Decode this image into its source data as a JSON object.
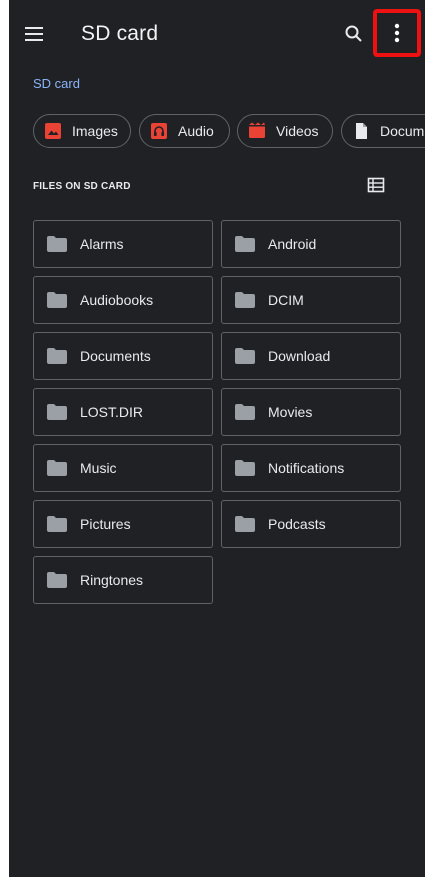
{
  "appbar": {
    "menu_icon": "hamburger-menu-icon",
    "title": "SD card",
    "search_icon": "search-icon",
    "overflow_icon": "more-vert-icon"
  },
  "breadcrumb": "SD card",
  "chips": [
    {
      "label": "Images",
      "icon": "image-icon",
      "icon_color": "#ea4335"
    },
    {
      "label": "Audio",
      "icon": "audio-icon",
      "icon_color": "#ea4335"
    },
    {
      "label": "Videos",
      "icon": "video-icon",
      "icon_color": "#ea4335"
    },
    {
      "label": "Docume",
      "icon": "document-icon",
      "icon_color": "#e8eaed"
    }
  ],
  "section": {
    "title": "FILES ON SD CARD",
    "view_toggle_icon": "list-view-icon"
  },
  "folders": [
    {
      "name": "Alarms"
    },
    {
      "name": "Android"
    },
    {
      "name": "Audiobooks"
    },
    {
      "name": "DCIM"
    },
    {
      "name": "Documents"
    },
    {
      "name": "Download"
    },
    {
      "name": "LOST.DIR"
    },
    {
      "name": "Movies"
    },
    {
      "name": "Music"
    },
    {
      "name": "Notifications"
    },
    {
      "name": "Pictures"
    },
    {
      "name": "Podcasts"
    },
    {
      "name": "Ringtones"
    }
  ],
  "colors": {
    "background": "#202124",
    "accent": "#8ab4f8",
    "highlight": "#ee1111",
    "chip_icon": "#ea4335"
  }
}
